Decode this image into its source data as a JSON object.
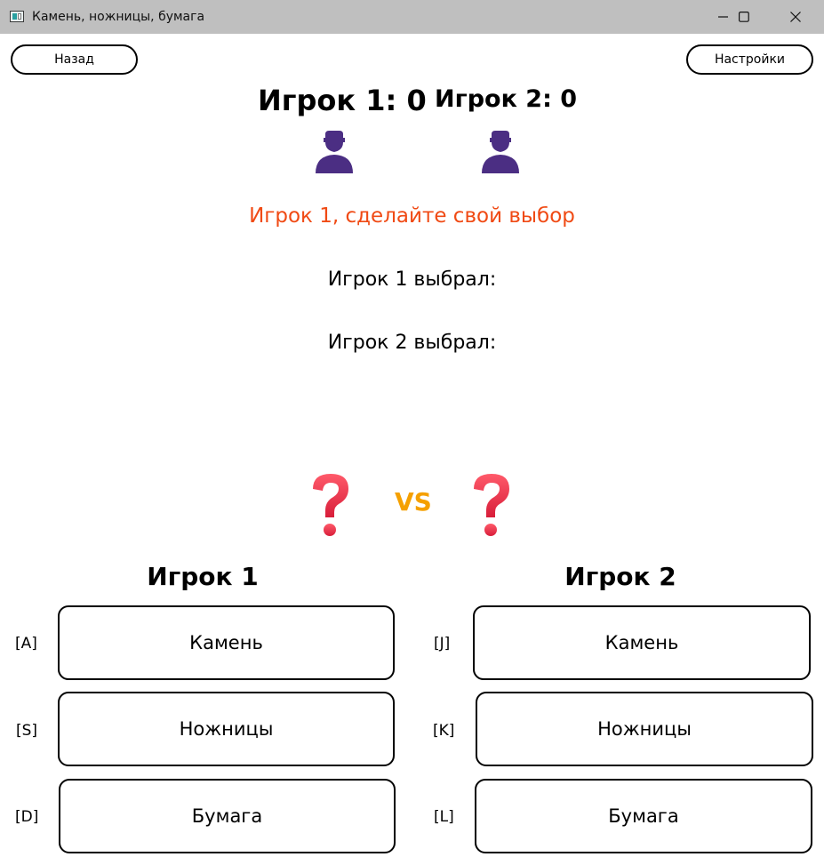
{
  "window": {
    "title": "Камень, ножницы, бумага",
    "controls": [
      "minimize-icon",
      "maximize-icon",
      "close-icon"
    ]
  },
  "toolbar": {
    "back_label": "Назад",
    "settings_label": "Настройки"
  },
  "scores": {
    "player1": "Игрок 1: 0",
    "player2": "Игрок 2: 0"
  },
  "status": {
    "prompt": "Игрок 1, сделайте свой выбор",
    "prompt_color": "#f04a14",
    "player1_choice": "Игрок 1 выбрал:",
    "player2_choice": "Игрок 2 выбрал:"
  },
  "versus": {
    "left_icon": "question-mark-icon",
    "label": "VS",
    "right_icon": "question-mark-icon",
    "color": "#f5a000"
  },
  "player1_panel": {
    "heading": "Игрок 1",
    "buttons": [
      {
        "key": "[A]",
        "label": "Камень"
      },
      {
        "key": "[S]",
        "label": "Ножницы"
      },
      {
        "key": "[D]",
        "label": "Бумага"
      }
    ]
  },
  "player2_panel": {
    "heading": "Игрок 2",
    "buttons": [
      {
        "key": "[J]",
        "label": "Камень"
      },
      {
        "key": "[K]",
        "label": "Ножницы"
      },
      {
        "key": "[L]",
        "label": "Бумага"
      }
    ]
  },
  "colors": {
    "avatar": "#4b2e83",
    "question": "#e83a4c"
  }
}
